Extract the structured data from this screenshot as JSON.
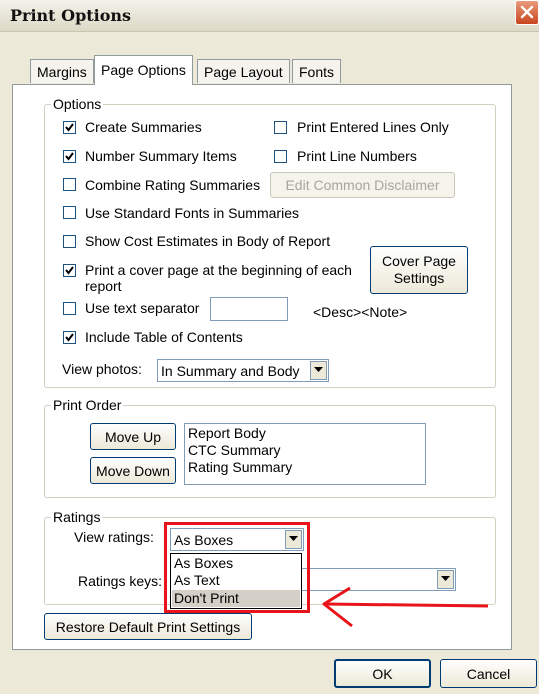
{
  "window": {
    "title": "Print Options"
  },
  "tabs": [
    {
      "label": "Margins",
      "active": false
    },
    {
      "label": "Page Options",
      "active": true
    },
    {
      "label": "Page Layout",
      "active": false
    },
    {
      "label": "Fonts",
      "active": false
    }
  ],
  "options": {
    "legend": "Options",
    "create_summaries": {
      "label": "Create Summaries",
      "checked": true
    },
    "print_entered_lines_only": {
      "label": "Print Entered Lines Only",
      "checked": false
    },
    "number_summary_items": {
      "label": "Number Summary Items",
      "checked": true
    },
    "print_line_numbers": {
      "label": "Print Line Numbers",
      "checked": false
    },
    "combine_rating_summaries": {
      "label": "Combine Rating Summaries",
      "checked": false
    },
    "edit_common_disclaimer": "Edit Common Disclaimer",
    "use_standard_fonts": {
      "label": "Use Standard Fonts in Summaries",
      "checked": false
    },
    "show_cost_estimates": {
      "label": "Show Cost Estimates in Body of Report",
      "checked": false
    },
    "print_cover_page": {
      "label_line1": "Print a cover page at the beginning of each",
      "label_line2": "report",
      "checked": true
    },
    "cover_page_settings_line1": "Cover Page",
    "cover_page_settings_line2": "Settings",
    "use_text_separator": {
      "label": "Use text separator",
      "checked": false
    },
    "text_separator_value": "",
    "separator_hint": "<Desc><Note>",
    "include_toc": {
      "label": "Include Table of Contents",
      "checked": true
    },
    "view_photos_label": "View photos:",
    "view_photos_value": "In Summary and Body"
  },
  "print_order": {
    "legend": "Print Order",
    "move_up": "Move Up",
    "move_down": "Move Down",
    "items": [
      "Report Body",
      "CTC Summary",
      "Rating Summary"
    ]
  },
  "ratings": {
    "legend": "Ratings",
    "view_ratings_label": "View ratings:",
    "view_ratings_value": "As Boxes",
    "options": [
      "As Boxes",
      "As Text",
      "Don't Print"
    ],
    "highlighted_option": "Don't Print",
    "ratings_keys_label": "Ratings keys:",
    "ratings_keys_value": ""
  },
  "restore_defaults": "Restore Default Print Settings",
  "footer": {
    "ok": "OK",
    "cancel": "Cancel"
  },
  "annotation_color": "#e8141a"
}
